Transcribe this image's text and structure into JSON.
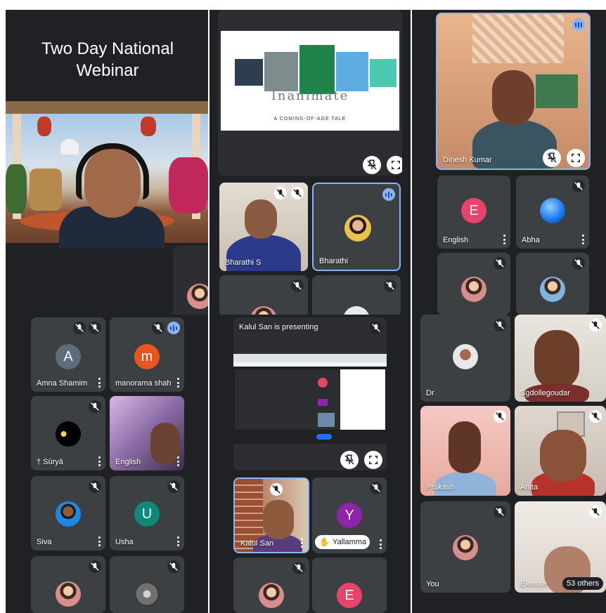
{
  "panel_left_top": {
    "title": "Two Day National Webinar"
  },
  "panel_mid_top": {
    "slide_title": "Inanimate",
    "slide_subtitle": "A COMING-OF-AGE TALE",
    "tiles": [
      {
        "name": "Bharathi S"
      },
      {
        "name": "Bharathi"
      }
    ]
  },
  "panel_right_top": {
    "tiles": [
      {
        "name": "Dinesh Kumar"
      },
      {
        "name": "English",
        "initial": "E"
      },
      {
        "name": "Abha"
      }
    ]
  },
  "panel_left_bottom": {
    "tiles": [
      {
        "name": "Amna Shamim",
        "initial": "A"
      },
      {
        "name": "manorama shah",
        "initial": "m"
      },
      {
        "name": "† Sūryā"
      },
      {
        "name": "English"
      },
      {
        "name": "Siva"
      },
      {
        "name": "Usha",
        "initial": "U"
      }
    ]
  },
  "panel_mid_bottom": {
    "presenting_text": "Kalul San is presenting",
    "tiles": [
      {
        "name": "Kalul San"
      },
      {
        "name": "Yallamma",
        "initial": "Y"
      },
      {
        "initial": "E"
      }
    ]
  },
  "panel_right_bottom": {
    "tiles": [
      {
        "name": "Dr"
      },
      {
        "name": "Sgdollegoudar"
      },
      {
        "name": "Prakash"
      },
      {
        "name": "Anita"
      },
      {
        "name": "You"
      },
      {
        "name": "Elenore"
      }
    ],
    "others_count": "53 others"
  },
  "colors": {
    "tile_bg": "#3c4043",
    "panel_bg": "#202124",
    "active_border": "#8ab4f8",
    "avatar_english": "#e8436a",
    "avatar_abha": "#1a73e8",
    "avatar_amna": "#5f6c7b",
    "avatar_manorama": "#e8561f",
    "avatar_usha": "#0b8a7b",
    "avatar_yallamma": "#8e24aa",
    "avatar_e": "#e8436a"
  }
}
